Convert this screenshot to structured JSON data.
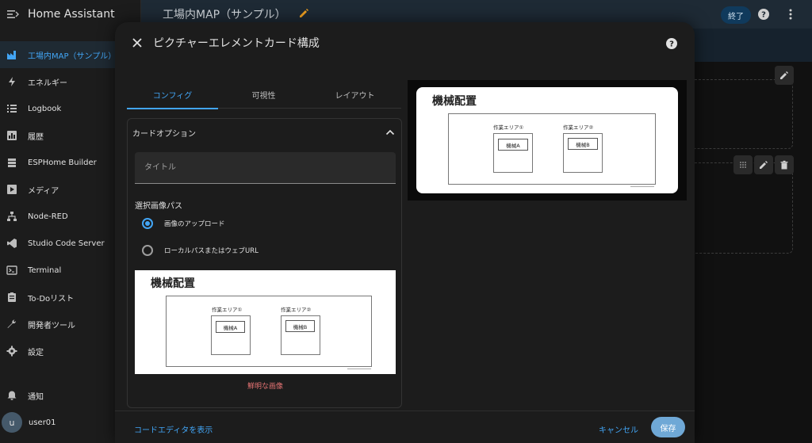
{
  "app": {
    "name": "Home Assistant"
  },
  "sidebar": {
    "items": [
      {
        "label": "工場内MAP（サンプル）",
        "icon": "factory-icon"
      },
      {
        "label": "エネルギー",
        "icon": "lightning-icon"
      },
      {
        "label": "Logbook",
        "icon": "list-icon"
      },
      {
        "label": "履歴",
        "icon": "chart-box-icon"
      },
      {
        "label": "ESPHome Builder",
        "icon": "server-icon"
      },
      {
        "label": "メディア",
        "icon": "play-box-icon"
      },
      {
        "label": "Node-RED",
        "icon": "sitemap-icon"
      },
      {
        "label": "Studio Code Server",
        "icon": "vscode-icon"
      },
      {
        "label": "Terminal",
        "icon": "console-icon"
      },
      {
        "label": "To-Doリスト",
        "icon": "clipboard-list-icon"
      },
      {
        "label": "開発者ツール",
        "icon": "wrench-icon"
      },
      {
        "label": "設定",
        "icon": "cog-icon"
      },
      {
        "label": "通知",
        "icon": "bell-icon"
      }
    ],
    "user": {
      "initial": "u",
      "name": "user01"
    }
  },
  "topbar": {
    "title": "工場内MAP（サンプル）",
    "done_label": "終了"
  },
  "dialog": {
    "title": "ピクチャーエレメントカード構成",
    "tabs": [
      "コンフィグ",
      "可視性",
      "レイアウト"
    ],
    "active_tab": 0,
    "section_title": "カードオプション",
    "title_field": {
      "placeholder": "タイトル",
      "value": ""
    },
    "image_path_label": "選択画像パス",
    "radio_options": [
      {
        "label": "画像のアップロード",
        "selected": true
      },
      {
        "label": "ローカルパスまたはウェブURL",
        "selected": false
      }
    ],
    "image_caption": "鮮明な画像",
    "footer": {
      "code_editor_label": "コードエディタを表示",
      "cancel_label": "キャンセル",
      "save_label": "保存"
    }
  },
  "map_image": {
    "title": "機械配置",
    "areas": [
      {
        "label": "作業エリア①",
        "machine": "機械A"
      },
      {
        "label": "作業エリア②",
        "machine": "機械B"
      }
    ]
  },
  "colors": {
    "accent": "#42a5f5",
    "sidebar_bg": "#1c1c1c",
    "topbar_bg": "#1e2a35",
    "dialog_bg": "#1c1c1c",
    "caption_error": "#e57373",
    "save_button": "#6fa8d6",
    "pencil": "#f0a020"
  }
}
